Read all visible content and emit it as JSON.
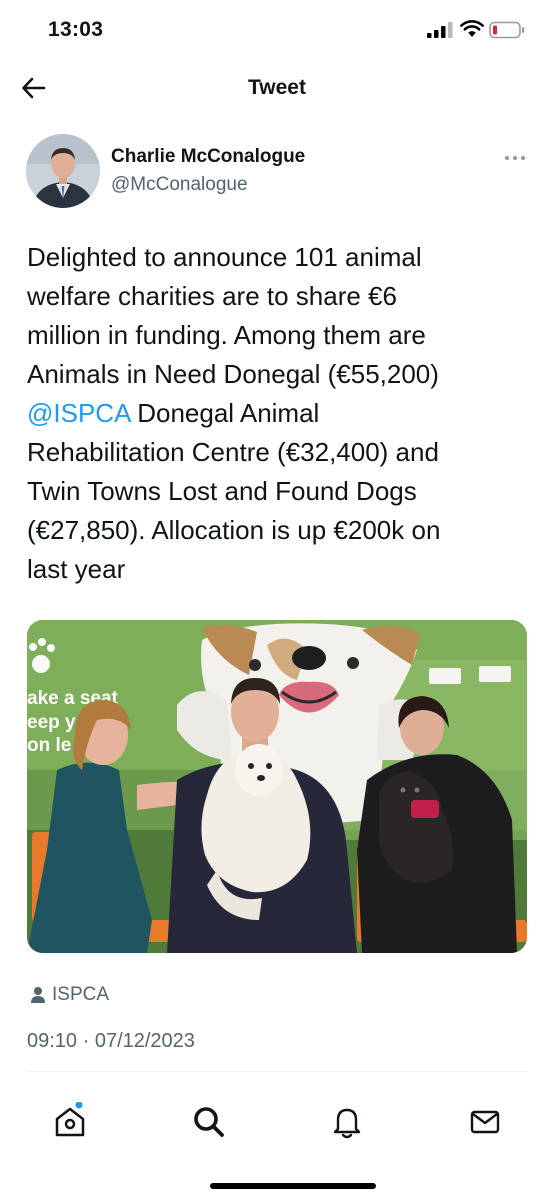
{
  "status_bar": {
    "time": "13:03",
    "battery_color": "#e0242d"
  },
  "nav": {
    "title": "Tweet",
    "back_icon": "back-arrow-icon"
  },
  "author": {
    "name": "Charlie McConalogue",
    "handle": "@McConalogue"
  },
  "tweet": {
    "text_before": "Delighted to announce 101 animal\nwelfare charities are to share €6\nmillion in funding. Among them are\nAnimals in Need Donegal (€55,200)\n",
    "mention": "@ISPCA",
    "text_after": " Donegal Animal\nRehabilitation Centre (€32,400) and\nTwin Towns Lost and Found Dogs\n(€27,850). Allocation is up €200k on\nlast year",
    "mention_color": "#1d9bf0"
  },
  "media": {
    "sign_lines": [
      "ake a seat",
      "eep y",
      "on le"
    ]
  },
  "tagged": {
    "label": "ISPCA"
  },
  "timestamp": "09:10 · 07/12/2023",
  "tab_bar": {
    "items": [
      "home-icon",
      "search-icon",
      "notifications-icon",
      "messages-icon"
    ],
    "notification_dot_color": "#1d9bf0"
  }
}
